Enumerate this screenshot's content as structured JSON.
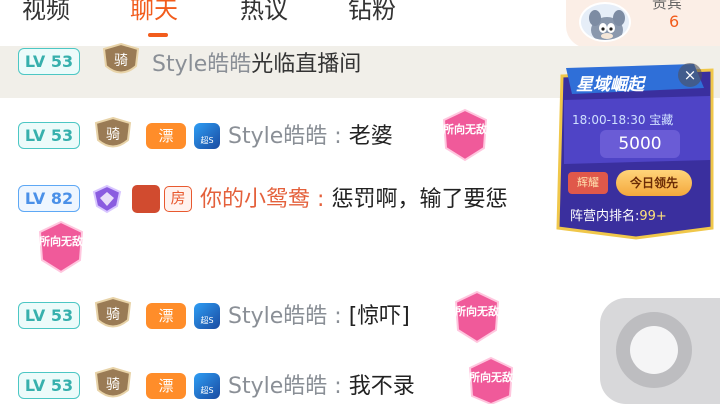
{
  "tabs": [
    {
      "label": "视频",
      "active": false
    },
    {
      "label": "聊天",
      "active": true
    },
    {
      "label": "热议",
      "active": false
    },
    {
      "label": "钻粉",
      "active": false
    }
  ],
  "user_panel": {
    "label": "贵宾",
    "count": "6",
    "avatar": "tom-cat-avatar"
  },
  "welcome": {
    "level": "LV 53",
    "badge": "骑",
    "nick": "Style皓皓",
    "text": "光临直播间"
  },
  "messages": [
    {
      "level": "LV 53",
      "badges": [
        "骑",
        "漂",
        "超S"
      ],
      "nick": "Style皓皓",
      "sep": ":",
      "text": "老婆",
      "sticker": "所向无敌"
    },
    {
      "level": "LV 82",
      "badges": [
        "purple-crest",
        "gold-badge",
        "房"
      ],
      "nick": "你的小鸳鸯",
      "sep": ":",
      "text": "惩罚啊，输了要惩",
      "sticker": "所向无敌"
    },
    {
      "level": "LV 53",
      "badges": [
        "骑",
        "漂",
        "超S"
      ],
      "nick": "Style皓皓",
      "sep": ":",
      "text": "[惊吓]",
      "sticker": "所向无敌"
    },
    {
      "level": "LV 53",
      "badges": [
        "骑",
        "漂",
        "超S"
      ],
      "nick": "Style皓皓",
      "sep": ":",
      "text": "我不录",
      "sticker": "所向无敌"
    }
  ],
  "event_card": {
    "title": "星域崛起",
    "time_label": "18:00-18:30 宝藏",
    "amount": "5000",
    "glory": "辉耀",
    "status": "今日领先",
    "rank_label": "阵营内排名:",
    "rank_value": "99+",
    "close": "×"
  },
  "colors": {
    "accent": "#f25c1c",
    "welcome_bg": "#f1efe9",
    "level_teal": "#4cc7c4",
    "level_blue": "#5ea8f5",
    "sticker_pink": "#f05a9a",
    "event_bg": "#3a2f9e"
  }
}
